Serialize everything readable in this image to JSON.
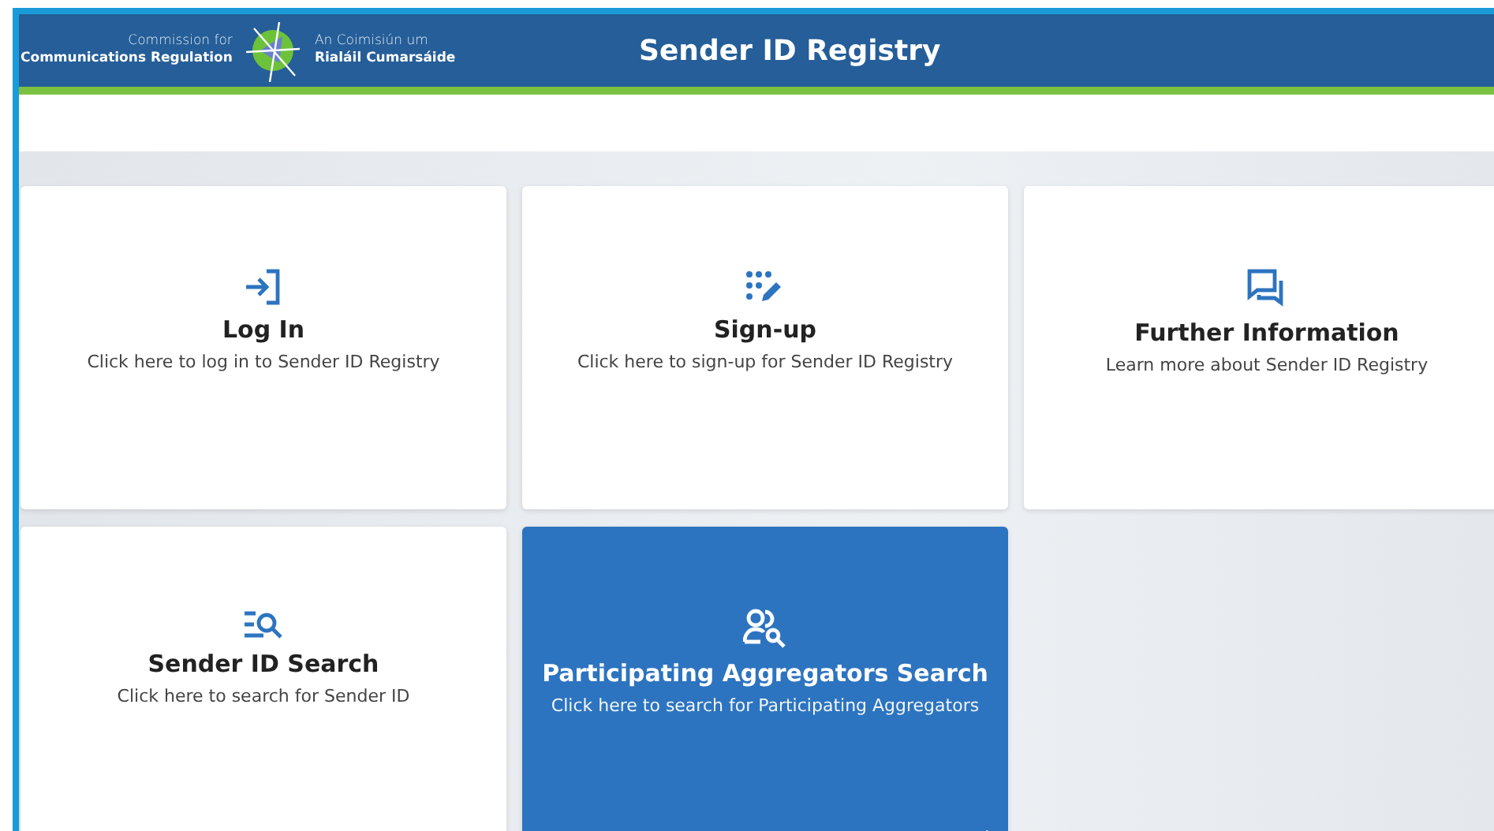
{
  "header": {
    "logo": {
      "line_1_en": "Commission for",
      "line_2_en": "Communications Regulation",
      "line_1_ga": "An Coimisiún um",
      "line_2_ga": "Rialáil Cumarsáide"
    },
    "title": "Sender ID Registry"
  },
  "cards": [
    {
      "kind": "login",
      "title": "Log In",
      "description": "Click here to log in to Sender ID Registry",
      "selected": false
    },
    {
      "kind": "signup",
      "title": "Sign-up",
      "description": "Click here to sign-up for Sender ID Registry",
      "selected": false
    },
    {
      "kind": "info",
      "title": "Further Information",
      "description": "Learn more about Sender ID Registry",
      "selected": false
    },
    {
      "kind": "search",
      "title": "Sender ID Search",
      "description": "Click here to search for Sender ID",
      "selected": false
    },
    {
      "kind": "people-search",
      "title": "Participating Aggregators Search",
      "description": "Click here to search for Participating Aggregators",
      "selected": true
    }
  ]
}
